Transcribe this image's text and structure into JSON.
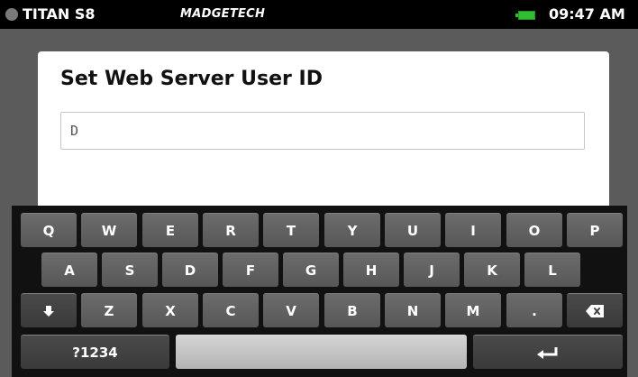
{
  "status_bar": {
    "device_name": "TITAN S8",
    "brand": "MADGETECH",
    "time": "09:47 AM",
    "battery_color": "#2fbf2f"
  },
  "dialog": {
    "title": "Set Web Server User ID",
    "input_value": "D"
  },
  "keyboard": {
    "row1": [
      "Q",
      "W",
      "E",
      "R",
      "T",
      "Y",
      "U",
      "I",
      "O",
      "P"
    ],
    "row2": [
      "A",
      "S",
      "D",
      "F",
      "G",
      "H",
      "J",
      "K",
      "L"
    ],
    "row3": [
      "Z",
      "X",
      "C",
      "V",
      "B",
      "N",
      "M",
      "."
    ],
    "shift_icon": "shift-down-arrow-icon",
    "backspace_icon": "backspace-icon",
    "symbols_label": "?1234",
    "enter_icon": "enter-return-icon"
  }
}
